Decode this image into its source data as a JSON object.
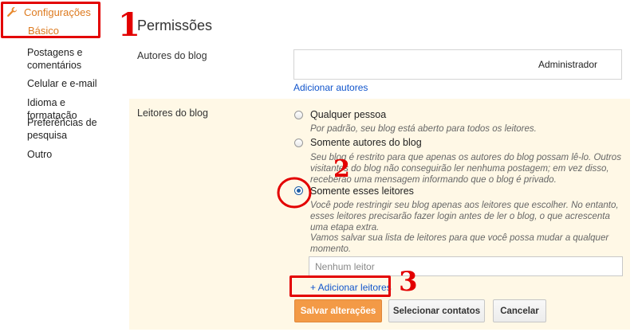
{
  "sidebar": {
    "header": "Configurações",
    "items": [
      {
        "label": "Básico"
      },
      {
        "label": "Postagens e comentários"
      },
      {
        "label": "Celular e e-mail"
      },
      {
        "label": "Idioma e formatação"
      },
      {
        "label": "Preferências de pesquisa"
      },
      {
        "label": "Outro"
      }
    ]
  },
  "main": {
    "title": "Permissões",
    "authors": {
      "label": "Autores do blog",
      "role": "Administrador",
      "add_link": "Adicionar autores"
    },
    "readers": {
      "label": "Leitores do blog",
      "options": [
        {
          "label": "Qualquer pessoa",
          "description": "Por padrão, seu blog está aberto para todos os leitores."
        },
        {
          "label": "Somente autores do blog",
          "description": "Seu blog é restrito para que apenas os autores do blog possam lê-lo. Outros visitantes do blog não conseguirão ler nenhuma postagem; em vez disso, receberão uma mensagem informando que o blog é privado."
        },
        {
          "label": "Somente esses leitores",
          "description": "Você pode restringir seu blog apenas aos leitores que escolher. No entanto, esses leitores precisarão fazer login antes de ler o blog, o que acrescenta uma etapa extra.",
          "note": "Vamos salvar sua lista de leitores para que você possa mudar a qualquer momento.",
          "selected": true
        }
      ],
      "input_placeholder": "Nenhum leitor",
      "add_link": "+ Adicionar leitores"
    },
    "buttons": {
      "save": "Salvar alterações",
      "select_contacts": "Selecionar contatos",
      "cancel": "Cancelar"
    }
  },
  "annotations": {
    "step1": "1",
    "step2": "2",
    "step3": "3",
    "color": "#e30000"
  },
  "colors": {
    "accent": "#dd7a1f",
    "link": "#1155cc",
    "panel": "#fff8e6",
    "primary_button": "#f39a46"
  }
}
